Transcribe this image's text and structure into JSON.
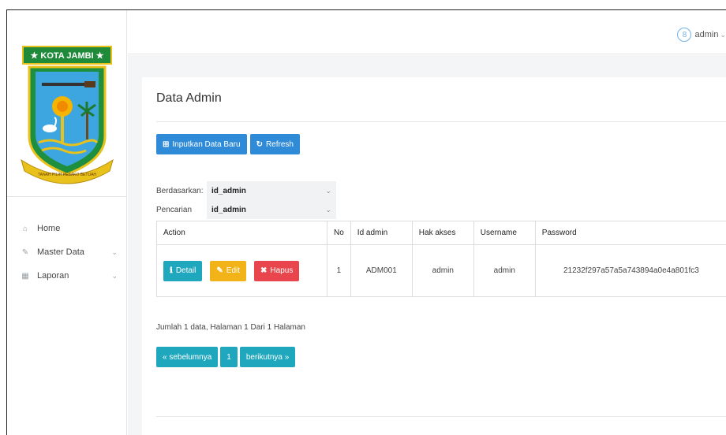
{
  "sidebar": {
    "logo_text": "★ KOTA JAMBI ★",
    "logo_motto": "TANAH PILIH PESAKO BETUAH",
    "items": [
      {
        "label": "Home",
        "icon": "home-icon",
        "has_arrow": false
      },
      {
        "label": "Master Data",
        "icon": "edit-icon",
        "has_arrow": true
      },
      {
        "label": "Laporan",
        "icon": "calendar-icon",
        "has_arrow": true
      }
    ]
  },
  "topbar": {
    "user_name": "admin",
    "user_initial": "8"
  },
  "page": {
    "title": "Data Admin",
    "add_button": "Inputkan Data Baru",
    "refresh_button": "Refresh",
    "filter_label": "Berdasarkan:",
    "filter_value": "id_admin",
    "search_label": "Pencarian",
    "search_value": "id_admin"
  },
  "table": {
    "headers": [
      "Action",
      "No",
      "Id admin",
      "Hak akses",
      "Username",
      "Password"
    ],
    "rows": [
      {
        "no": "1",
        "id_admin": "ADM001",
        "hak_akses": "admin",
        "username": "admin",
        "password": "21232f297a57a5a743894a0e4a801fc3",
        "detail_label": "Detail",
        "edit_label": "Edit",
        "delete_label": "Hapus"
      }
    ]
  },
  "footer": {
    "summary": "Jumlah 1 data, Halaman 1 Dari 1 Halaman",
    "prev_label": "« sebelumnya",
    "page_label": "1",
    "next_label": "berikutnya »"
  },
  "colors": {
    "primary": "#2f8bd8",
    "info": "#1fa7bd",
    "warning": "#f2b318",
    "danger": "#e8464c"
  }
}
